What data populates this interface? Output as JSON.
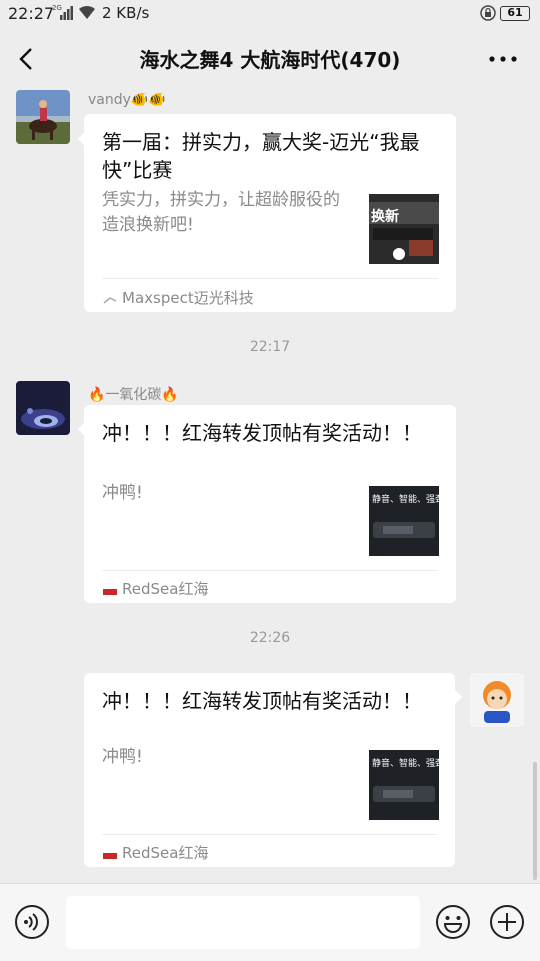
{
  "status_bar": {
    "time": "22:27",
    "network": "2G",
    "speed": "2 KB/s",
    "battery": "61"
  },
  "header": {
    "title": "海水之舞4 大航海时代(470)"
  },
  "messages": [
    {
      "sender": "vandy🐠🐠",
      "card": {
        "title": "第一届：拼实力，赢大奖-迈光“我最快”比赛",
        "desc": "凭实力，拼实力，让超龄服役的造浪换新吧!",
        "thumb_text": "换新",
        "source": "Maxspect迈光科技"
      }
    },
    {
      "timestamp": "22:17"
    },
    {
      "sender": "🔥一氧化碳🔥",
      "card": {
        "title": "冲！！！红海转发顶帖有奖活动！！",
        "desc": "冲鸭!",
        "thumb_text": "静音、智能、强劲",
        "source": "RedSea红海"
      }
    },
    {
      "timestamp": "22:26"
    },
    {
      "sender": "",
      "card": {
        "title": "冲！！！红海转发顶帖有奖活动！！",
        "desc": "冲鸭!",
        "thumb_text": "静音、智能、强劲",
        "source": "RedSea红海"
      }
    }
  ],
  "colors": {
    "background": "#ededed",
    "card": "#ffffff",
    "muted_text": "#8a8a8a"
  }
}
